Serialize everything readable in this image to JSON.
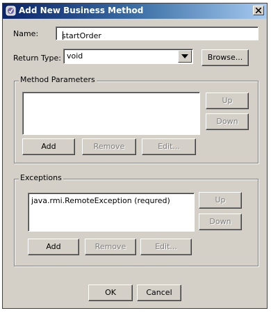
{
  "window": {
    "title": "Add New Business Method",
    "close_icon": "close-icon"
  },
  "form": {
    "name_label": "Name:",
    "name_value": "startOrder",
    "return_type_label": "Return Type:",
    "return_type_value": "void",
    "browse_label": "Browse..."
  },
  "method_parameters": {
    "title": "Method Parameters",
    "items": [],
    "up_label": "Up",
    "down_label": "Down",
    "add_label": "Add",
    "remove_label": "Remove",
    "edit_label": "Edit..."
  },
  "exceptions": {
    "title": "Exceptions",
    "items": [
      "java.rmi.RemoteException (requred)"
    ],
    "up_label": "Up",
    "down_label": "Down",
    "add_label": "Add",
    "remove_label": "Remove",
    "edit_label": "Edit..."
  },
  "footer": {
    "ok_label": "OK",
    "cancel_label": "Cancel"
  },
  "colors": {
    "title_bar": "#0a246a",
    "dialog_bg": "#d4d0c8"
  }
}
